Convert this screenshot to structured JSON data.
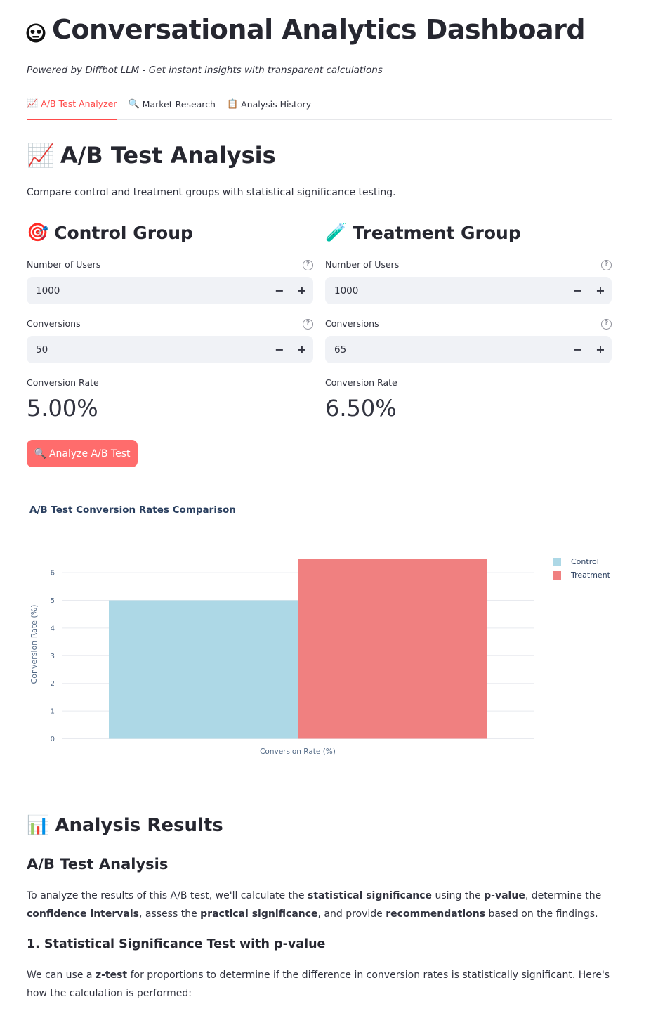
{
  "app": {
    "title": "Conversational Analytics Dashboard",
    "subtitle": "Powered by Diffbot LLM - Get instant insights with transparent calculations"
  },
  "tabs": [
    {
      "icon": "📈",
      "label": "A/B Test Analyzer"
    },
    {
      "icon": "🔍",
      "label": "Market Research"
    },
    {
      "icon": "📋",
      "label": "Analysis History"
    }
  ],
  "ab": {
    "heading": "A/B Test Analysis",
    "description": "Compare control and treatment groups with statistical significance testing.",
    "control": {
      "heading": "Control Group",
      "users_label": "Number of Users",
      "users_value": "1000",
      "conversions_label": "Conversions",
      "conversions_value": "50",
      "rate_label": "Conversion Rate",
      "rate_value": "5.00%"
    },
    "treatment": {
      "heading": "Treatment Group",
      "users_label": "Number of Users",
      "users_value": "1000",
      "conversions_label": "Conversions",
      "conversions_value": "65",
      "rate_label": "Conversion Rate",
      "rate_value": "6.50%"
    },
    "analyze_button": "Analyze A/B Test",
    "help_glyph": "?",
    "minus_glyph": "−",
    "plus_glyph": "+"
  },
  "chart_data": {
    "type": "bar",
    "title": "A/B Test Conversion Rates Comparison",
    "xlabel": "Conversion Rate (%)",
    "ylabel": "Conversion Rate (%)",
    "categories": [
      "Conversion Rate (%)"
    ],
    "series": [
      {
        "name": "Control",
        "values": [
          5.0
        ],
        "color": "#add8e6"
      },
      {
        "name": "Treatment",
        "values": [
          6.5
        ],
        "color": "#f08080"
      }
    ],
    "ylim": [
      0,
      6.8
    ],
    "yticks": [
      0,
      1,
      2,
      3,
      4,
      5,
      6
    ],
    "grid": true,
    "legend_position": "top-right"
  },
  "results": {
    "heading": "Analysis Results",
    "subheading": "A/B Test Analysis",
    "p1": [
      {
        "t": "To analyze the results of this A/B test, we'll calculate the ",
        "b": false
      },
      {
        "t": "statistical significance",
        "b": true
      },
      {
        "t": " using the ",
        "b": false
      },
      {
        "t": "p-value",
        "b": true
      },
      {
        "t": ", determine the ",
        "b": false
      },
      {
        "t": "confidence intervals",
        "b": true
      },
      {
        "t": ", assess the ",
        "b": false
      },
      {
        "t": "practical significance",
        "b": true
      },
      {
        "t": ", and provide ",
        "b": false
      },
      {
        "t": "recommendations",
        "b": true
      },
      {
        "t": " based on the findings.",
        "b": false
      }
    ],
    "section1_heading": "1. Statistical Significance Test with p-value",
    "p2": [
      {
        "t": "We can use a ",
        "b": false
      },
      {
        "t": "z-test",
        "b": true
      },
      {
        "t": " for proportions to determine if the difference in conversion rates is statistically significant. Here's how the calculation is performed:",
        "b": false
      }
    ]
  }
}
